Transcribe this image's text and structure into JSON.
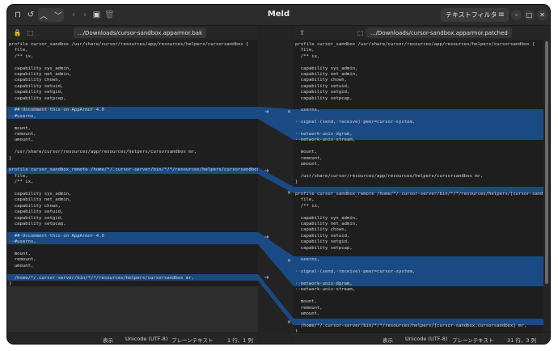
{
  "window": {
    "title": "Meld",
    "filter_button": "テキストフィルター"
  },
  "toolbar": {
    "icons": [
      "diff-icon",
      "history-icon",
      "prev-change-icon",
      "next-change-icon",
      "back-icon",
      "forward-icon",
      "save-icon",
      "delete-icon"
    ],
    "menu_icon": "hamburger-icon",
    "window_controls": [
      "minimize-icon",
      "maximize-icon",
      "close-icon"
    ]
  },
  "left_path": ".../Downloads/cursor-sandbox.apparmor.bak",
  "right_path": ".../Downloads/cursor-sandbox.apparmor.patched",
  "left_lines": [
    "profile cursor_sandbox /usr/share/cursor/resources/app/resources/helpers/cursorsandbox {",
    "  file,",
    "  /** ix,",
    "",
    "  capability sys_admin,",
    "  capability net_admin,",
    "  capability chown,",
    "  capability setuid,",
    "  capability setgid,",
    "  capability setpcap,",
    "",
    "  ##·Uncomment·this·on·AppArmor·4.0",
    "··#userns,",
    "",
    "  mount,",
    "  remount,",
    "  umount,",
    "",
    "  /usr/share/cursor/resources/app/resources/helpers/cursorsandbox mr,",
    "}",
    "",
    "profile cursor_sandbox_remote /home/*/.cursor-server/bin/*/*/resources/helpers/cursorsandbox {",
    "  file,",
    "  /** ix,",
    "",
    "  capability sys_admin,",
    "  capability net_admin,",
    "  capability chown,",
    "  capability setuid,",
    "  capability setgid,",
    "  capability setpcap,",
    "",
    "  ##·Uncomment·this·on·AppArmor·4.0",
    "··#userns,",
    "",
    "  mount,",
    "  remount,",
    "  umount,",
    "",
    "  /home/*/.cursor-server/bin/*/*/resources/helpers/cursorsandbox mr,",
    "}"
  ],
  "right_lines": [
    "profile cursor_sandbox /usr/share/cursor/resources/app/resources/helpers/cursorsandbox {",
    "  file,",
    "  /** ix,",
    "",
    "  capability sys_admin,",
    "  capability net_admin,",
    "  capability chown,",
    "  capability setuid,",
    "  capability setgid,",
    "  capability setpcap,",
    "",
    "  userns,",
    "",
    "··signal·(send,·receive)·peer=cursor-system,",
    "",
    "··network·unix·dgram,",
    "··network·unix·stream,",
    "",
    "  mount,",
    "  remount,",
    "  umount,",
    "",
    "  /usr/share/cursor/resources/app/resources/helpers/cursorsandbox mr,",
    "}",
    "",
    "profile cursor_sandbox_remote /home/*/.cursor-server/bin/*/*/resources/helpers/[cursor-sandbox,",
    "  file,",
    "  /** ix,",
    "",
    "  capability sys_admin,",
    "  capability net_admin,",
    "  capability chown,",
    "  capability setuid,",
    "  capability setgid,",
    "  capability setpcap,",
    "",
    "  userns,",
    "",
    "··signal·(send,·receive)·peer=cursor-system,",
    "",
    "··network·unix·dgram,",
    "··network·unix·stream,",
    "",
    "  mount,",
    "  remount,",
    "  umount,",
    "",
    "  /home/*/.cursor-server/bin/*/*/resources/helpers/[cursor-sandbox,cursorsandbox] mr,",
    "}"
  ],
  "status_left": {
    "view": "表示",
    "encoding": "Unicode (UTF-8)",
    "syntax": "プレーンテキスト",
    "position": "1 行、1 列"
  },
  "status_right": {
    "view": "表示",
    "encoding": "Unicode (UTF-8)",
    "syntax": "プレーンテキスト",
    "position": "31 行、3 列"
  }
}
